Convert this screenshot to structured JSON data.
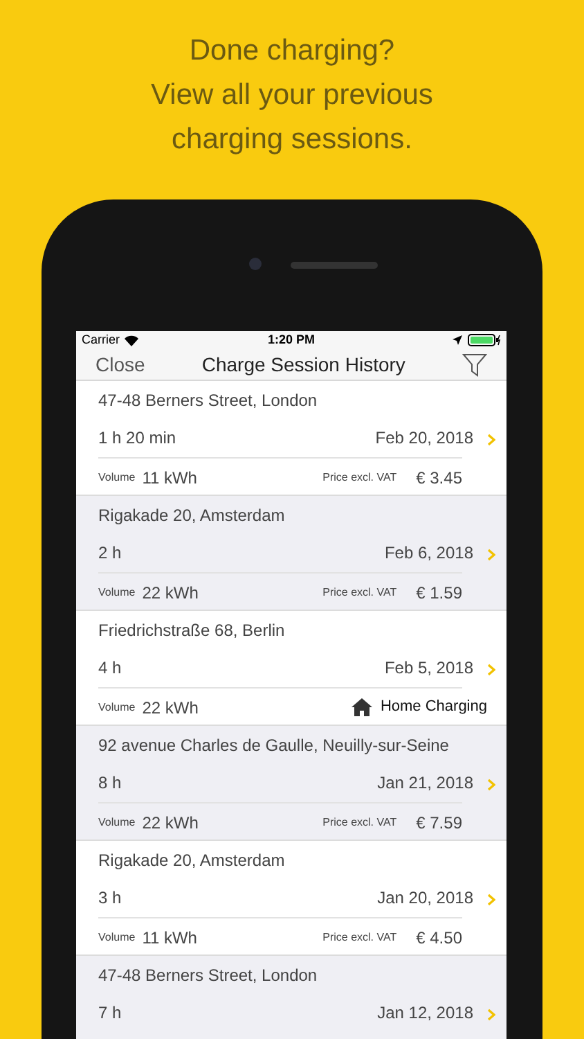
{
  "headline": [
    "Done charging?",
    "View all your previous",
    "charging sessions."
  ],
  "status_bar": {
    "carrier": "Carrier",
    "time": "1:20 PM"
  },
  "nav": {
    "close": "Close",
    "title": "Charge Session History"
  },
  "sessions": [
    {
      "kind": "price",
      "address": "47-48 Berners Street, London",
      "duration": "1 h 20 min",
      "date": "Feb 20, 2018",
      "volume_label": "Volume",
      "volume": "11 kWh",
      "price_label": "Price excl. VAT",
      "price": "€ 3.45"
    },
    {
      "kind": "price",
      "address": "Rigakade 20, Amsterdam",
      "duration": "2 h",
      "date": "Feb 6, 2018",
      "volume_label": "Volume",
      "volume": "22 kWh",
      "price_label": "Price excl. VAT",
      "price": "€ 1.59"
    },
    {
      "kind": "home",
      "address": "Friedrichstraße 68, Berlin",
      "duration": "4 h",
      "date": "Feb 5, 2018",
      "volume_label": "Volume",
      "volume": "22 kWh",
      "home_label": "Home Charging"
    },
    {
      "kind": "price",
      "address": "92 avenue Charles de Gaulle, Neuilly-sur-Seine",
      "duration": "8 h",
      "date": "Jan 21, 2018",
      "volume_label": "Volume",
      "volume": "22 kWh",
      "price_label": "Price excl. VAT",
      "price": "€ 7.59"
    },
    {
      "kind": "price",
      "address": "Rigakade 20, Amsterdam",
      "duration": "3 h",
      "date": "Jan 20, 2018",
      "volume_label": "Volume",
      "volume": "11 kWh",
      "price_label": "Price excl. VAT",
      "price": "€ 4.50"
    },
    {
      "address": "47-48 Berners Street, London",
      "duration": "7 h",
      "date": "Jan 12, 2018"
    }
  ]
}
